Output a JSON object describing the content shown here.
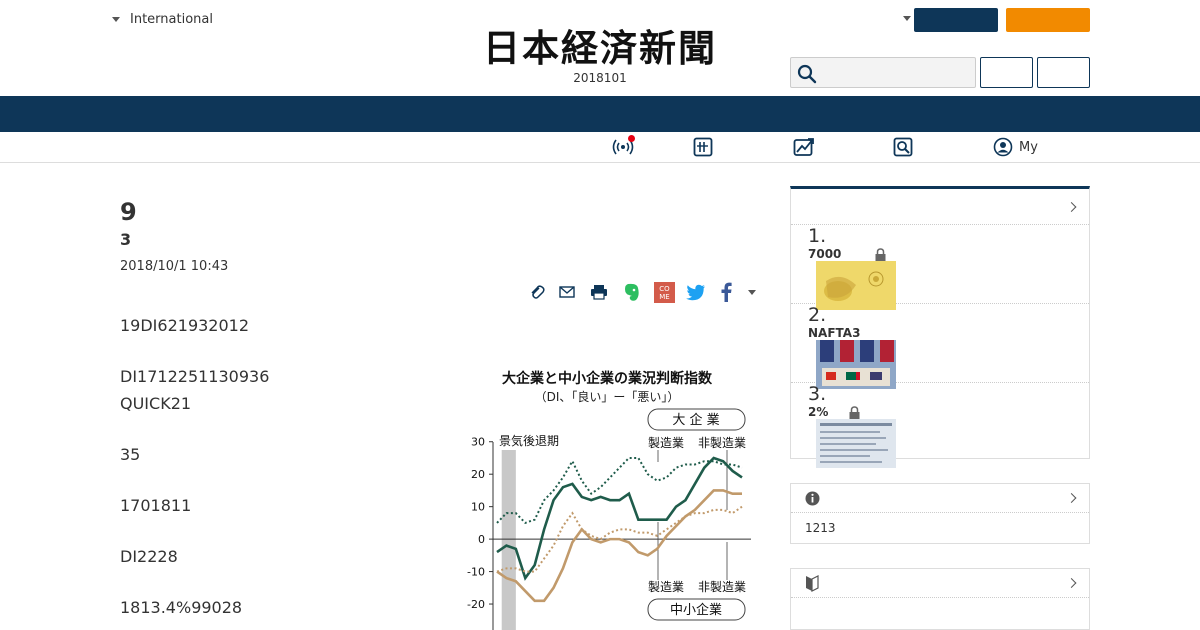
{
  "header": {
    "edition_label": "International",
    "logo_text": "日本経済新聞",
    "date_code": "2018101"
  },
  "subnav": {
    "my_label": "My"
  },
  "article": {
    "title": "9",
    "subtitle": "3",
    "published": "2018/10/1 10:43",
    "paragraphs": [
      "19DI621932012",
      "DI1712251130936",
      "QUICK21",
      "35",
      "1701811",
      "DI2228",
      "1813.4%99028"
    ],
    "figure": {
      "title": "大企業と中小企業の業況判断指数",
      "subtitle": "（DI、「良い」ー「悪い」）",
      "recession_label": "景気後退期",
      "large_badge": "大 企 業",
      "small_badge": "中小企業",
      "label_mfg": "製造業",
      "label_nonmfg": "非製造業",
      "y_ticks": [
        "30",
        "20",
        "10",
        "0",
        "-10",
        "-20"
      ]
    }
  },
  "chart_data": {
    "type": "line",
    "title": "大企業と中小企業の業況判断指数",
    "subtitle": "（DI、「良い」ー「悪い」）",
    "ylim": [
      -28,
      33
    ],
    "yticks": [
      30,
      20,
      10,
      0,
      -10,
      -20
    ],
    "annotations": [
      "景気後退期",
      "大 企 業",
      "中小企業",
      "製造業",
      "非製造業"
    ],
    "colors": {
      "large": "#1f5c4b",
      "small": "#c19a6b",
      "recession": "#c8c8c8"
    },
    "series": [
      {
        "name": "",
        "group": "large",
        "industry": "manufacturing",
        "style": "solid",
        "values": [
          -4,
          -2,
          -3,
          -12,
          -8,
          3,
          12,
          16,
          17,
          13,
          12,
          13,
          12,
          12,
          14,
          6,
          6,
          6,
          6,
          10,
          12,
          17,
          22,
          25,
          24,
          21,
          19
        ]
      },
      {
        "name": "",
        "group": "large",
        "industry": "non-manufacturing",
        "style": "dotted",
        "values": [
          5,
          8,
          8,
          5,
          6,
          12,
          15,
          19,
          24,
          18,
          14,
          16,
          19,
          22,
          25,
          25,
          20,
          18,
          19,
          22,
          23,
          23,
          24,
          24,
          23,
          23,
          22
        ]
      },
      {
        "name": "",
        "group": "small",
        "industry": "manufacturing",
        "style": "solid",
        "values": [
          -10,
          -12,
          -13,
          -16,
          -19,
          -19,
          -15,
          -9,
          -1,
          3,
          0,
          -1,
          0,
          0,
          -1,
          -4,
          -5,
          -3,
          1,
          4,
          7,
          9,
          12,
          15,
          15,
          14,
          14
        ]
      },
      {
        "name": "",
        "group": "small",
        "industry": "non-manufacturing",
        "style": "dotted",
        "values": [
          -10,
          -9,
          -9,
          -10,
          -10,
          -6,
          -2,
          4,
          8,
          3,
          1,
          0,
          2,
          3,
          3,
          2,
          2,
          1,
          3,
          5,
          7,
          8,
          8,
          9,
          9,
          8,
          10
        ]
      }
    ],
    "recession_band": {
      "from_index": 0.5,
      "to_index": 2
    }
  },
  "share": {
    "icons": [
      "clip-icon",
      "mail-icon",
      "print-icon",
      "evernote-icon",
      "come-icon",
      "twitter-icon",
      "facebook-icon",
      "more-icon"
    ],
    "come_text": "COME"
  },
  "sidebar": {
    "ranking": [
      {
        "rank": "1.",
        "text": "7000",
        "locked": true
      },
      {
        "rank": "2.",
        "text": "NAFTA3",
        "locked": false
      },
      {
        "rank": "3.",
        "text": "2%",
        "locked": true
      }
    ],
    "info_body": "1213"
  }
}
